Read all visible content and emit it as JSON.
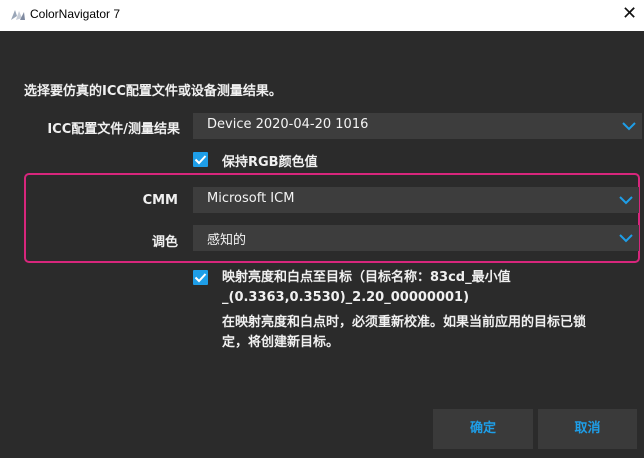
{
  "window": {
    "title": "ColorNavigator 7",
    "close_symbol": "✕"
  },
  "dialog": {
    "prompt": "选择要仿真的ICC配置文件或设备测量结果。",
    "profile": {
      "label": "ICC配置文件/测量结果",
      "value": "Device 2020-04-20 1016"
    },
    "keep_rgb": {
      "label": "保持RGB颜色值",
      "checked": true
    },
    "cmm": {
      "label": "CMM",
      "value": "Microsoft ICM"
    },
    "intent": {
      "label": "调色",
      "value": "感知的"
    },
    "map_target": {
      "checked": true,
      "line1": "映射亮度和白点至目标（目标名称：83cd_最小值",
      "line2": "_(0.3363,0.3530)_2.20_00000001)",
      "line3": "在映射亮度和白点时，必须重新校准。如果当前应用的目标已锁",
      "line4": "定，将创建新目标。"
    },
    "buttons": {
      "ok": "确定",
      "cancel": "取消"
    }
  },
  "colors": {
    "accent": "#1e9ee8",
    "highlight": "#d7267c",
    "background": "#2b2b2b",
    "field": "#3d3d3d"
  },
  "icons": [
    "app-icon",
    "close-icon",
    "chevron-down-icon",
    "checkmark-icon"
  ]
}
